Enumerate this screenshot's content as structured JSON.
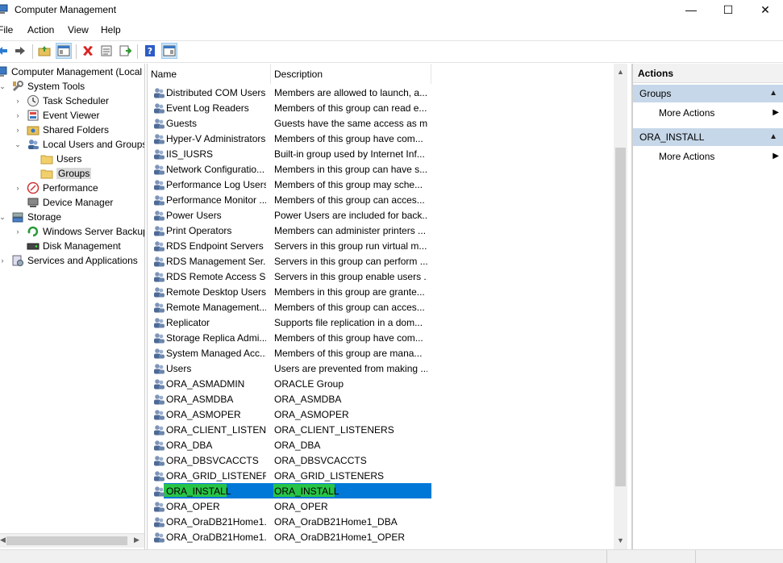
{
  "window": {
    "title": "Computer Management",
    "minimize": "—",
    "maximize": "☐",
    "close": "✕"
  },
  "menu": [
    "File",
    "Action",
    "View",
    "Help"
  ],
  "tree": [
    {
      "label": "Computer Management (Local",
      "depth": 0,
      "chevron": "",
      "icon": "computer-icon"
    },
    {
      "label": "System Tools",
      "depth": 1,
      "chevron": "⌄",
      "icon": "tools-icon"
    },
    {
      "label": "Task Scheduler",
      "depth": 2,
      "chevron": "›",
      "icon": "clock-icon"
    },
    {
      "label": "Event Viewer",
      "depth": 2,
      "chevron": "›",
      "icon": "event-viewer-icon"
    },
    {
      "label": "Shared Folders",
      "depth": 2,
      "chevron": "›",
      "icon": "shared-folder-icon"
    },
    {
      "label": "Local Users and Groups",
      "depth": 2,
      "chevron": "⌄",
      "icon": "users-icon"
    },
    {
      "label": "Users",
      "depth": 3,
      "chevron": "",
      "icon": "folder-icon"
    },
    {
      "label": "Groups",
      "depth": 3,
      "chevron": "",
      "icon": "folder-icon",
      "selected": true
    },
    {
      "label": "Performance",
      "depth": 2,
      "chevron": "›",
      "icon": "performance-icon"
    },
    {
      "label": "Device Manager",
      "depth": 2,
      "chevron": "",
      "icon": "device-manager-icon"
    },
    {
      "label": "Storage",
      "depth": 1,
      "chevron": "⌄",
      "icon": "storage-icon"
    },
    {
      "label": "Windows Server Backup",
      "depth": 2,
      "chevron": "›",
      "icon": "backup-icon"
    },
    {
      "label": "Disk Management",
      "depth": 2,
      "chevron": "",
      "icon": "disk-icon"
    },
    {
      "label": "Services and Applications",
      "depth": 1,
      "chevron": "›",
      "icon": "services-icon"
    }
  ],
  "list": {
    "columns": [
      "Name",
      "Description"
    ],
    "rows": [
      {
        "name": "Distributed COM Users",
        "desc": "Members are allowed to launch, a..."
      },
      {
        "name": "Event Log Readers",
        "desc": "Members of this group can read e..."
      },
      {
        "name": "Guests",
        "desc": "Guests have the same access as m..."
      },
      {
        "name": "Hyper-V Administrators",
        "desc": "Members of this group have com..."
      },
      {
        "name": "IIS_IUSRS",
        "desc": "Built-in group used by Internet Inf..."
      },
      {
        "name": "Network Configuratio...",
        "desc": "Members in this group can have s..."
      },
      {
        "name": "Performance Log Users",
        "desc": "Members of this group may sche..."
      },
      {
        "name": "Performance Monitor ...",
        "desc": "Members of this group can acces..."
      },
      {
        "name": "Power Users",
        "desc": "Power Users are included for back..."
      },
      {
        "name": "Print Operators",
        "desc": "Members can administer printers ..."
      },
      {
        "name": "RDS Endpoint Servers",
        "desc": "Servers in this group run virtual m..."
      },
      {
        "name": "RDS Management Ser...",
        "desc": "Servers in this group can perform ..."
      },
      {
        "name": "RDS Remote Access S...",
        "desc": "Servers in this group enable users ..."
      },
      {
        "name": "Remote Desktop Users",
        "desc": "Members in this group are grante..."
      },
      {
        "name": "Remote Management...",
        "desc": "Members of this group can acces..."
      },
      {
        "name": "Replicator",
        "desc": "Supports file replication in a dom..."
      },
      {
        "name": "Storage Replica Admi...",
        "desc": "Members of this group have com..."
      },
      {
        "name": "System Managed Acc...",
        "desc": "Members of this group are mana..."
      },
      {
        "name": "Users",
        "desc": "Users are prevented from making ..."
      },
      {
        "name": "ORA_ASMADMIN",
        "desc": "ORACLE Group"
      },
      {
        "name": "ORA_ASMDBA",
        "desc": "ORA_ASMDBA"
      },
      {
        "name": "ORA_ASMOPER",
        "desc": "ORA_ASMOPER"
      },
      {
        "name": "ORA_CLIENT_LISTENE...",
        "desc": "ORA_CLIENT_LISTENERS"
      },
      {
        "name": "ORA_DBA",
        "desc": "ORA_DBA"
      },
      {
        "name": "ORA_DBSVCACCTS",
        "desc": "ORA_DBSVCACCTS"
      },
      {
        "name": "ORA_GRID_LISTENERS",
        "desc": "ORA_GRID_LISTENERS"
      },
      {
        "name": "ORA_INSTALL",
        "desc": "ORA_INSTALL",
        "selected": true
      },
      {
        "name": "ORA_OPER",
        "desc": "ORA_OPER"
      },
      {
        "name": "ORA_OraDB21Home1...",
        "desc": "ORA_OraDB21Home1_DBA"
      },
      {
        "name": "ORA_OraDB21Home1...",
        "desc": "ORA_OraDB21Home1_OPER"
      }
    ]
  },
  "actions": {
    "header": "Actions",
    "sections": [
      {
        "title": "Groups",
        "items": [
          "More Actions"
        ]
      },
      {
        "title": "ORA_INSTALL",
        "items": [
          "More Actions"
        ]
      }
    ]
  },
  "colors": {
    "selection": "#0078d7",
    "highlight": "#2fd12f",
    "section": "#c6d7e9"
  }
}
